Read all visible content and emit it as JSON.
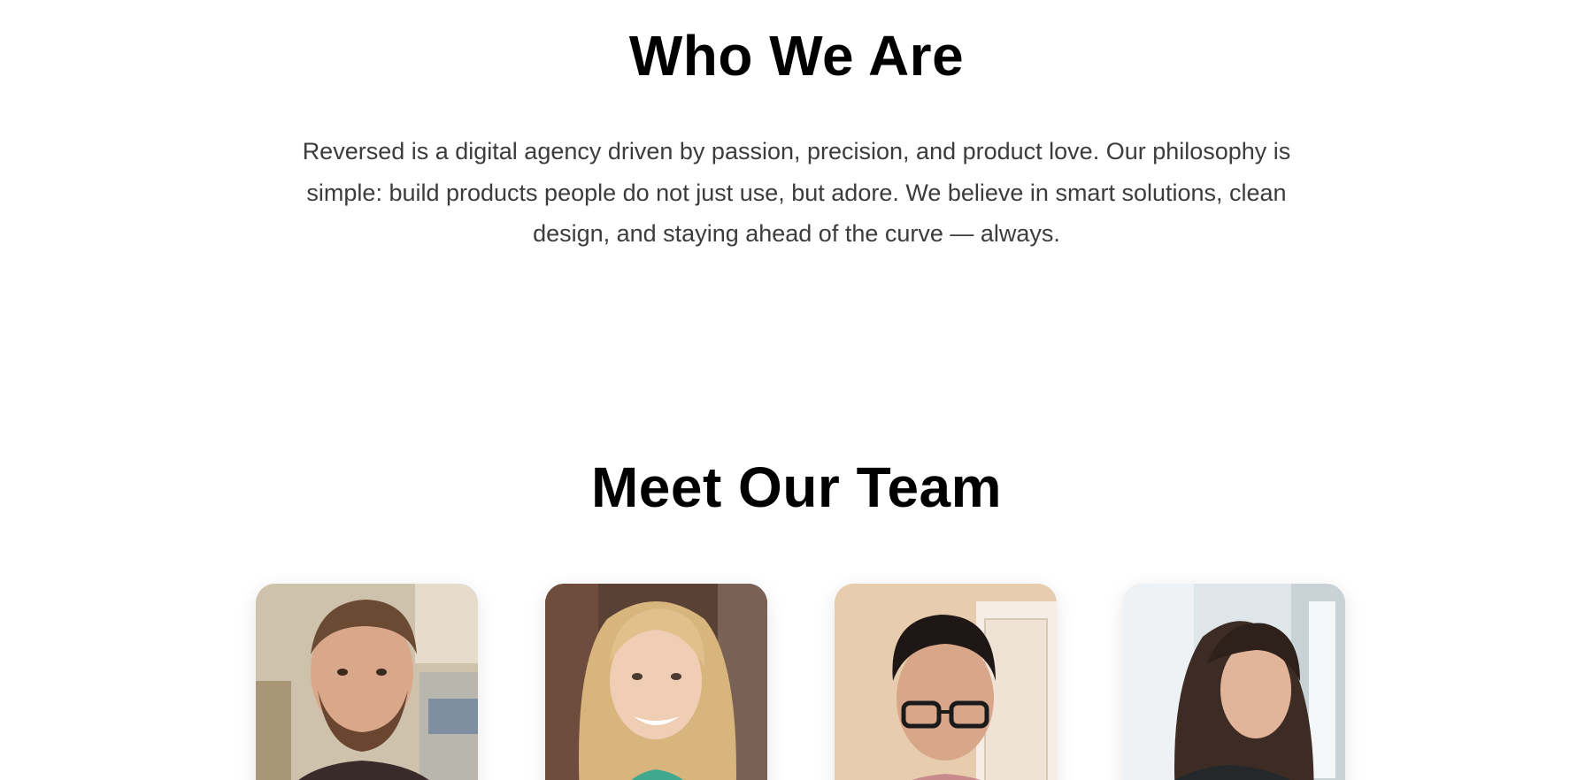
{
  "about": {
    "title": "Who We Are",
    "text": "Reversed is a digital agency driven by passion, precision, and product love. Our philosophy is simple: build products people do not just use, but adore. We believe in smart solutions, clean design, and staying ahead of the curve — always."
  },
  "team": {
    "title": "Meet Our Team",
    "members": [
      {
        "photo": "team-member-photo-man-beard"
      },
      {
        "photo": "team-member-photo-woman-blonde"
      },
      {
        "photo": "team-member-photo-man-glasses"
      },
      {
        "photo": "team-member-photo-woman-dark-hair"
      }
    ]
  }
}
